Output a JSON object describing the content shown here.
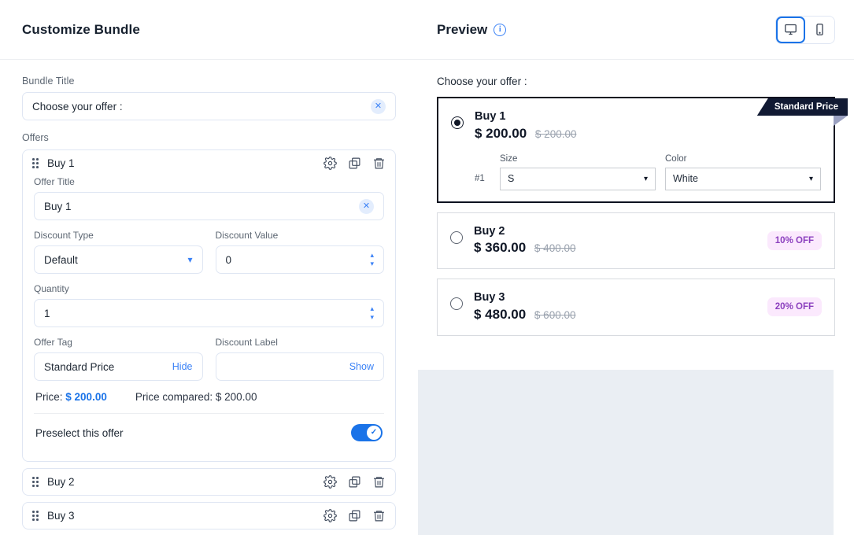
{
  "left": {
    "title": "Customize Bundle",
    "bundle_title_label": "Bundle Title",
    "bundle_title_value": "Choose your offer :",
    "clear_icon": "close-icon",
    "offers_label": "Offers",
    "expanded_offer": {
      "head_title": "Buy 1",
      "offer_title_label": "Offer Title",
      "offer_title_value": "Buy 1",
      "discount_type_label": "Discount Type",
      "discount_type_value": "Default",
      "discount_value_label": "Discount Value",
      "discount_value_value": "0",
      "quantity_label": "Quantity",
      "quantity_value": "1",
      "offer_tag_label": "Offer Tag",
      "offer_tag_value": "Standard Price",
      "offer_tag_action": "Hide",
      "discount_label_label": "Discount Label",
      "discount_label_value": "",
      "discount_label_action": "Show",
      "price_label": "Price:",
      "price_value": "$ 200.00",
      "price_compared_label": "Price compared:",
      "price_compared_value": "$ 200.00",
      "preselect_label": "Preselect this offer",
      "preselect_on": true
    },
    "collapsed_offers": [
      {
        "title": "Buy 2"
      },
      {
        "title": "Buy 3"
      }
    ],
    "row_icons": [
      "gear-icon",
      "duplicate-icon",
      "trash-icon"
    ]
  },
  "preview": {
    "title": "Preview",
    "info_icon": "info-icon",
    "info_glyph": "i",
    "devices": [
      {
        "name": "desktop-icon",
        "active": true
      },
      {
        "name": "mobile-icon",
        "active": false
      }
    ],
    "choose_label": "Choose your offer :",
    "offers": [
      {
        "name": "Buy 1",
        "price": "$ 200.00",
        "compare_price": "$ 200.00",
        "selected": true,
        "ribbon": "Standard Price",
        "badge": "",
        "variants": {
          "index": "#1",
          "fields": [
            {
              "label": "Size",
              "value": "S"
            },
            {
              "label": "Color",
              "value": "White"
            }
          ]
        }
      },
      {
        "name": "Buy 2",
        "price": "$ 360.00",
        "compare_price": "$ 400.00",
        "selected": false,
        "ribbon": "",
        "badge": "10% OFF"
      },
      {
        "name": "Buy 3",
        "price": "$ 480.00",
        "compare_price": "$ 600.00",
        "selected": false,
        "ribbon": "",
        "badge": "20% OFF"
      }
    ]
  },
  "colors": {
    "accent_blue": "#1a73e8",
    "ribbon_navy": "#111a33",
    "badge_bg": "#fbe9fd",
    "badge_text": "#8b3fbe",
    "panel_bg": "#eaeef3"
  }
}
